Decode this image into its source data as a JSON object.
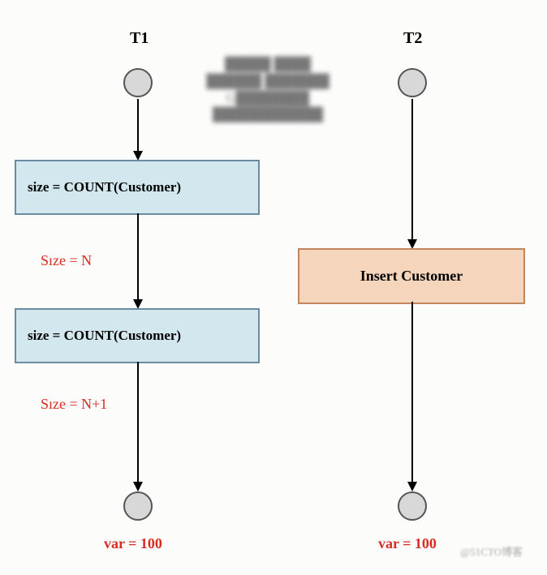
{
  "threads": {
    "t1": {
      "label": "T1"
    },
    "t2": {
      "label": "T2"
    }
  },
  "boxes": {
    "count1": "size = COUNT(Customer)",
    "count2": "size = COUNT(Customer)",
    "insert": "Insert Customer"
  },
  "annotations": {
    "size_n": "Sıze = N",
    "size_n1": "Sıze = N+1",
    "var_t1": "var = 100",
    "var_t2": "var = 100"
  },
  "blurred_text": "G",
  "watermark": "@51CTO博客"
}
